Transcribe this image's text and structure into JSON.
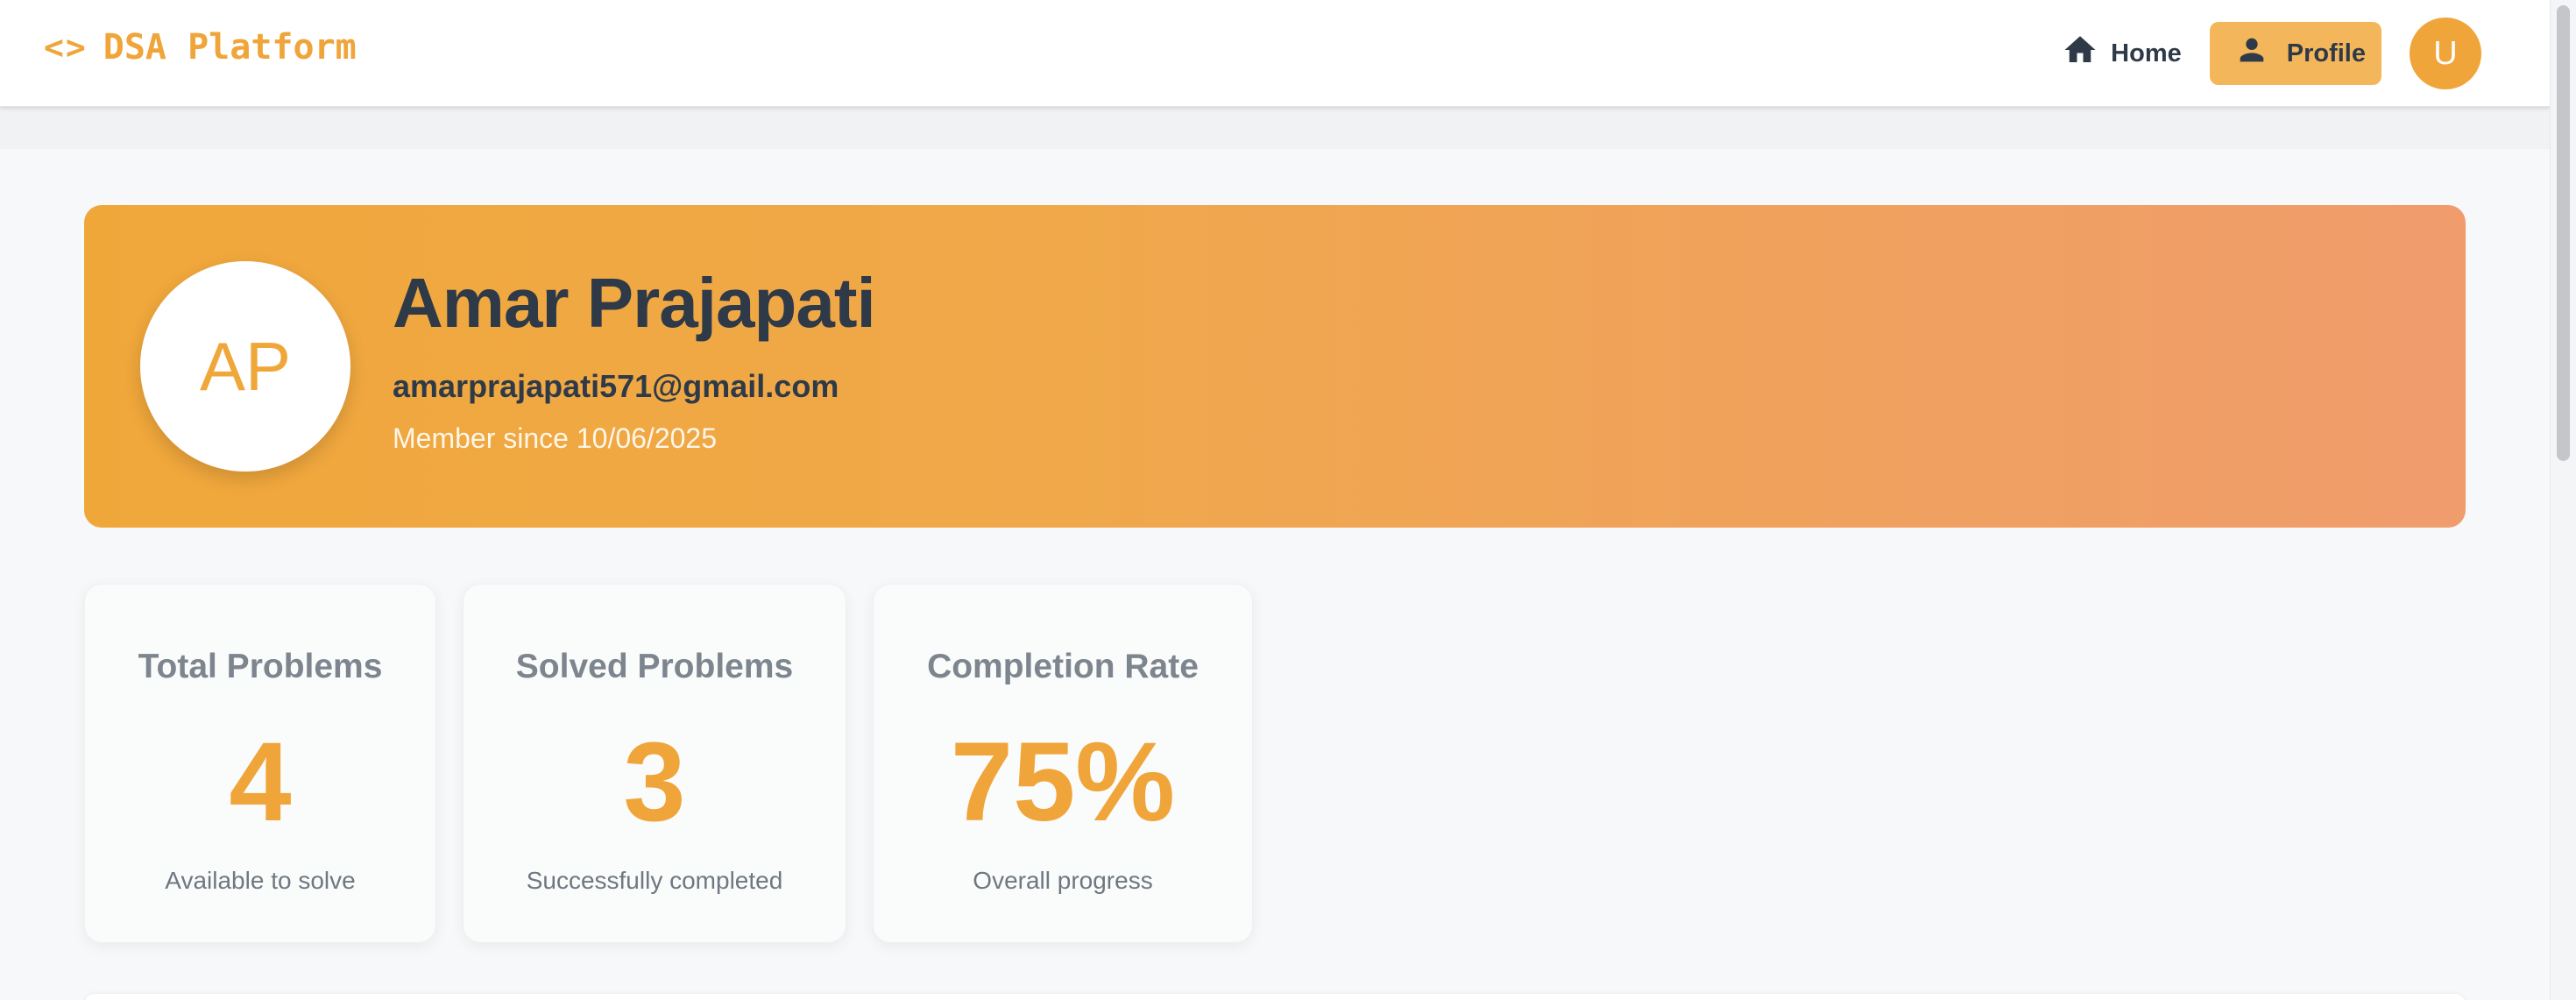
{
  "header": {
    "brand_icon": "<>",
    "brand_name": "DSA Platform",
    "nav": {
      "home_label": "Home",
      "profile_label": "Profile",
      "avatar_initial": "U"
    }
  },
  "profile": {
    "initials": "AP",
    "name": "Amar Prajapati",
    "email": "amarprajapati571@gmail.com",
    "member_since": "Member since 10/06/2025"
  },
  "stats": [
    {
      "title": "Total Problems",
      "value": "4",
      "subtitle": "Available to solve"
    },
    {
      "title": "Solved Problems",
      "value": "3",
      "subtitle": "Successfully completed"
    },
    {
      "title": "Completion Rate",
      "value": "75%",
      "subtitle": "Overall progress"
    }
  ],
  "colors": {
    "accent": "#f0a53a",
    "banner_gradient_start": "#f0a73a",
    "banner_gradient_end": "#f09c6d",
    "text_dark": "#2f3a48"
  },
  "icons": {
    "brand": "code-icon",
    "home": "home-icon",
    "profile": "person-icon"
  }
}
